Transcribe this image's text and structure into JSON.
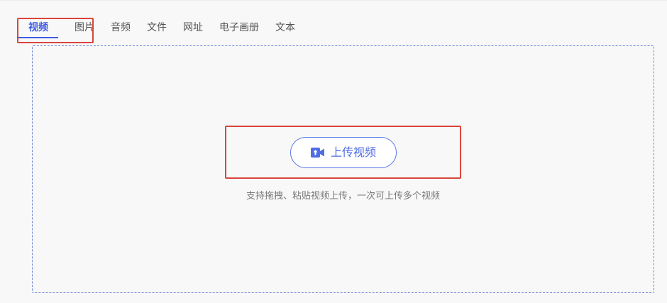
{
  "tabs": [
    {
      "label": "视频"
    },
    {
      "label": "图片"
    },
    {
      "label": "音频"
    },
    {
      "label": "文件"
    },
    {
      "label": "网址"
    },
    {
      "label": "电子画册"
    },
    {
      "label": "文本"
    }
  ],
  "active_tab": "视频",
  "upload": {
    "button_label": "上传视频",
    "icon": "video-upload-icon",
    "hint": "支持拖拽、粘贴视频上传，一次可上传多个视频"
  },
  "colors": {
    "accent": "#3f5de0",
    "highlight": "#d9453b",
    "dropzone_border": "#6e86d6"
  }
}
